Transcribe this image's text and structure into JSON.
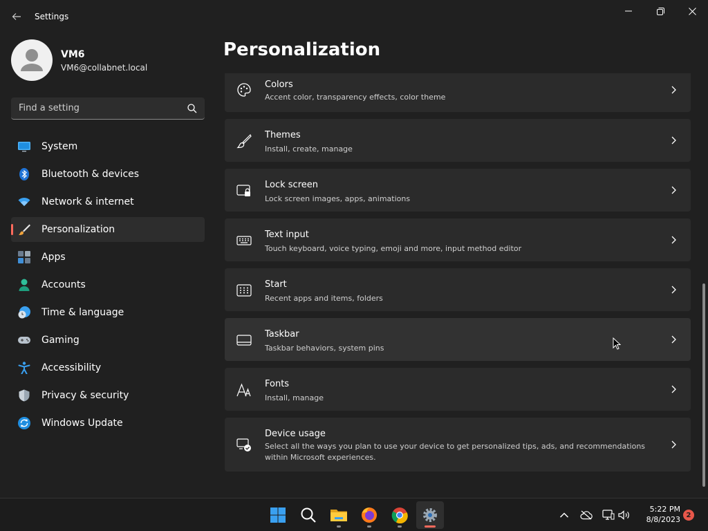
{
  "window": {
    "title": "Settings"
  },
  "user": {
    "name": "VM6",
    "email": "VM6@collabnet.local"
  },
  "search": {
    "placeholder": "Find a setting"
  },
  "nav": [
    {
      "label": "System",
      "icon": "monitor-icon"
    },
    {
      "label": "Bluetooth & devices",
      "icon": "bluetooth-icon"
    },
    {
      "label": "Network & internet",
      "icon": "wifi-icon"
    },
    {
      "label": "Personalization",
      "icon": "brush-icon",
      "active": true
    },
    {
      "label": "Apps",
      "icon": "apps-icon"
    },
    {
      "label": "Accounts",
      "icon": "person-icon"
    },
    {
      "label": "Time & language",
      "icon": "clock-globe-icon"
    },
    {
      "label": "Gaming",
      "icon": "gamepad-icon"
    },
    {
      "label": "Accessibility",
      "icon": "accessibility-icon"
    },
    {
      "label": "Privacy & security",
      "icon": "shield-icon"
    },
    {
      "label": "Windows Update",
      "icon": "sync-icon"
    }
  ],
  "page": {
    "title": "Personalization"
  },
  "cards": [
    {
      "title": "Colors",
      "subtitle": "Accent color, transparency effects, color theme",
      "icon": "palette-icon"
    },
    {
      "title": "Themes",
      "subtitle": "Install, create, manage",
      "icon": "brush-icon"
    },
    {
      "title": "Lock screen",
      "subtitle": "Lock screen images, apps, animations",
      "icon": "lock-screen-icon"
    },
    {
      "title": "Text input",
      "subtitle": "Touch keyboard, voice typing, emoji and more, input method editor",
      "icon": "keyboard-icon"
    },
    {
      "title": "Start",
      "subtitle": "Recent apps and items, folders",
      "icon": "start-grid-icon"
    },
    {
      "title": "Taskbar",
      "subtitle": "Taskbar behaviors, system pins",
      "icon": "taskbar-icon"
    },
    {
      "title": "Fonts",
      "subtitle": "Install, manage",
      "icon": "fonts-icon"
    },
    {
      "title": "Device usage",
      "subtitle": "Select all the ways you plan to use your device to get personalized tips, ads, and recommendations within Microsoft experiences.",
      "icon": "device-usage-icon"
    }
  ],
  "taskbar": {
    "apps": [
      "start-icon",
      "search-icon",
      "file-explorer-icon",
      "firefox-icon",
      "chrome-icon",
      "settings-gear-icon"
    ],
    "time": "5:22 PM",
    "date": "8/8/2023",
    "notifications": "2"
  },
  "colors": {
    "accent": "#ff6a5c",
    "background": "#202020",
    "card": "#2b2b2b"
  }
}
